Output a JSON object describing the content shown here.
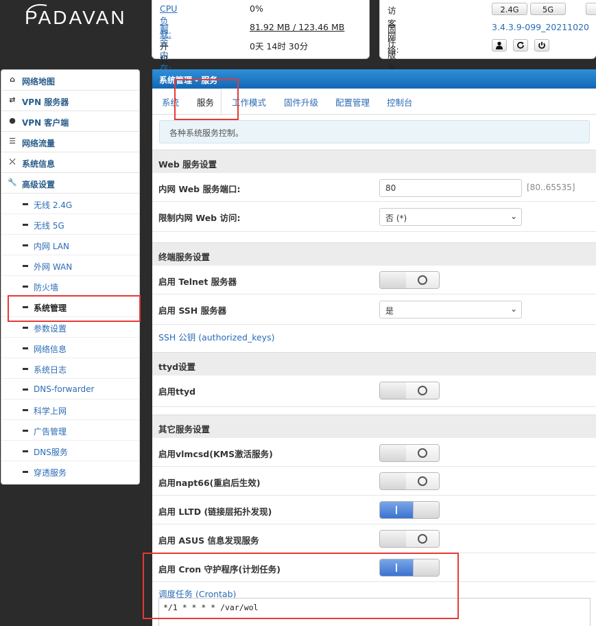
{
  "logo": {
    "text": "PADAVAN"
  },
  "status": {
    "cpu_label": "CPU 负载:",
    "cpu_value": "0%",
    "mem_label": "剩余内存:",
    "mem_value": "81.92 MB / 123.46 MB",
    "uptime_label": "开机时间:",
    "uptime_value": "0天 14时 30分",
    "guest_label": "访客网络:",
    "guest_24": "2.4G",
    "guest_5": "5G",
    "fw_label": "固件版本:",
    "fw_value": "3.4.3.9-099_20211020"
  },
  "sidebar": {
    "top_items": [
      {
        "label": "网络地图",
        "icon": "home-icon"
      },
      {
        "label": "VPN 服务器",
        "icon": "retweet-icon"
      },
      {
        "label": "VPN 客户端",
        "icon": "globe-icon"
      },
      {
        "label": "网络流量",
        "icon": "list-icon"
      },
      {
        "label": "系统信息",
        "icon": "random-icon"
      },
      {
        "label": "高级设置",
        "icon": "wrench-icon"
      }
    ],
    "sub_items": [
      {
        "label": "无线 2.4G"
      },
      {
        "label": "无线 5G"
      },
      {
        "label": "内网 LAN"
      },
      {
        "label": "外网 WAN"
      },
      {
        "label": "防火墙"
      },
      {
        "label": "系统管理"
      },
      {
        "label": "参数设置"
      },
      {
        "label": "网络信息"
      },
      {
        "label": "系统日志"
      },
      {
        "label": "DNS-forwarder"
      },
      {
        "label": "科学上网"
      },
      {
        "label": "广告管理"
      },
      {
        "label": "DNS服务"
      },
      {
        "label": "穿透服务"
      }
    ]
  },
  "main": {
    "title": "系统管理 - 服务",
    "tabs": [
      {
        "label": "系统"
      },
      {
        "label": "服务"
      },
      {
        "label": "工作模式"
      },
      {
        "label": "固件升级"
      },
      {
        "label": "配置管理"
      },
      {
        "label": "控制台"
      }
    ],
    "info": "各种系统服务控制。",
    "sections": {
      "web": "Web 服务设置",
      "terminal": "终端服务设置",
      "ttyd": "ttyd设置",
      "other": "其它服务设置"
    },
    "fields": {
      "web_port_label": "内网 Web 服务端口:",
      "web_port_value": "80",
      "web_port_hint": "[80..65535]",
      "web_limit_label": "限制内网 Web 访问:",
      "web_limit_value": "否 (*)",
      "telnet_label": "启用 Telnet 服务器",
      "ssh_label": "启用 SSH 服务器",
      "ssh_value": "是",
      "ssh_keys_link": "SSH 公钥 (authorized_keys)",
      "ttyd_label": "启用ttyd",
      "vlmcsd_label": "启用vlmcsd(KMS激活服务)",
      "napt66_label": "启用napt66(重启后生效)",
      "lltd_label": "启用 LLTD (链接层拓扑发现)",
      "asus_label": "启用 ASUS 信息发现服务",
      "cron_label": "启用 Cron 守护程序(计划任务)",
      "crontab_link": "调度任务 (Crontab)",
      "crontab_value": "*/1 * * * * /var/wol"
    }
  }
}
